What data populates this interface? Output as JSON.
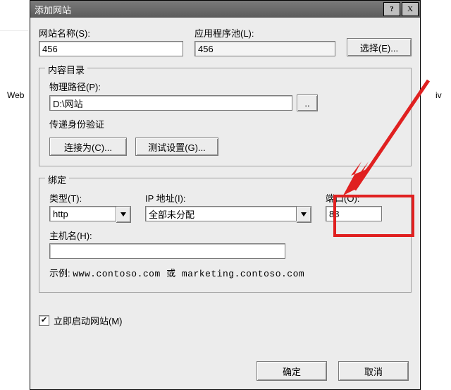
{
  "background": {
    "web_label": "Web",
    "right_hint": "iv"
  },
  "dialog": {
    "title": "添加网站",
    "help": "?",
    "close": "X",
    "site_name_label": "网站名称(S):",
    "site_name_value": "456",
    "app_pool_label": "应用程序池(L):",
    "app_pool_value": "456",
    "select_button": "选择(E)..."
  },
  "content_dir": {
    "group_title": "内容目录",
    "phys_path_label": "物理路径(P):",
    "phys_path_value": "D:\\网站",
    "browse_button": "..",
    "pass_auth_label": "传递身份验证",
    "connect_as_button": "连接为(C)...",
    "test_settings_button": "测试设置(G)..."
  },
  "binding": {
    "group_title": "绑定",
    "type_label": "类型(T):",
    "type_value": "http",
    "ip_label": "IP 地址(I):",
    "ip_value": "全部未分配",
    "port_label": "端口(O):",
    "port_value": "88",
    "host_label": "主机名(H):",
    "host_value": "",
    "example_label": "示例:",
    "example_text": "www.contoso.com 或 marketing.contoso.com"
  },
  "start_now": {
    "label": "立即启动网站(M)",
    "checked": true
  },
  "footer": {
    "ok": "确定",
    "cancel": "取消"
  },
  "annotation": {
    "color": "#e02020"
  }
}
